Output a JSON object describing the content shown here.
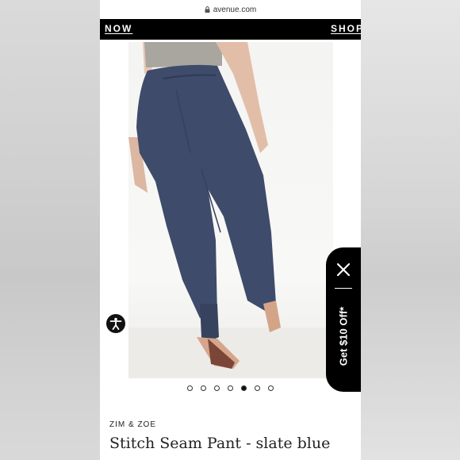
{
  "browser": {
    "url": "avenue.com"
  },
  "promo": {
    "left_text": "NOW",
    "right_text": "SHOP"
  },
  "gallery": {
    "slide_count": 7,
    "active_index": 4
  },
  "product": {
    "brand": "ZIM & ZOE",
    "title": "Stitch Seam Pant - slate blue"
  },
  "offer": {
    "label": "Get $10 Off*"
  },
  "icons": {
    "lock": "lock-icon",
    "accessibility": "accessibility-icon",
    "close": "close-icon"
  },
  "colors": {
    "pant": "#3e4b6b",
    "promo_bg": "#000000"
  }
}
